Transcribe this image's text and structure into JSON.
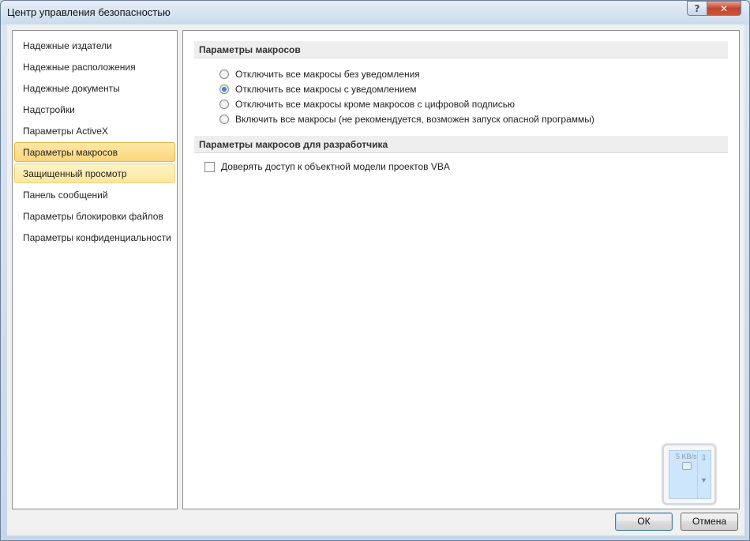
{
  "window": {
    "title": "Центр управления безопасностью",
    "help_glyph": "?",
    "close_glyph": "✕"
  },
  "sidebar": {
    "items": [
      {
        "label": "Надежные издатели",
        "state": "normal"
      },
      {
        "label": "Надежные расположения",
        "state": "normal"
      },
      {
        "label": "Надежные документы",
        "state": "normal"
      },
      {
        "label": "Надстройки",
        "state": "normal"
      },
      {
        "label": "Параметры ActiveX",
        "state": "normal"
      },
      {
        "label": "Параметры макросов",
        "state": "selected"
      },
      {
        "label": "Защищенный просмотр",
        "state": "hover"
      },
      {
        "label": "Панель сообщений",
        "state": "normal"
      },
      {
        "label": "Параметры блокировки файлов",
        "state": "normal"
      },
      {
        "label": "Параметры конфиденциальности",
        "state": "normal"
      }
    ]
  },
  "macros": {
    "header": "Параметры макросов",
    "options": [
      {
        "label": "Отключить все макросы без уведомления",
        "checked": false
      },
      {
        "label": "Отключить все макросы с уведомлением",
        "checked": true
      },
      {
        "label": "Отключить все макросы кроме макросов с цифровой подписью",
        "checked": false
      },
      {
        "label": "Включить все макросы (не рекомендуется, возможен запуск опасной программы)",
        "checked": false
      }
    ]
  },
  "developer": {
    "header": "Параметры макросов для разработчика",
    "vba_trust_label": "Доверять доступ к объектной модели проектов VBA",
    "vba_trust_checked": false
  },
  "netmon": {
    "speed": "5 KB/s",
    "icon": "network-icon"
  },
  "buttons": {
    "ok": "ОК",
    "cancel": "Отмена"
  }
}
